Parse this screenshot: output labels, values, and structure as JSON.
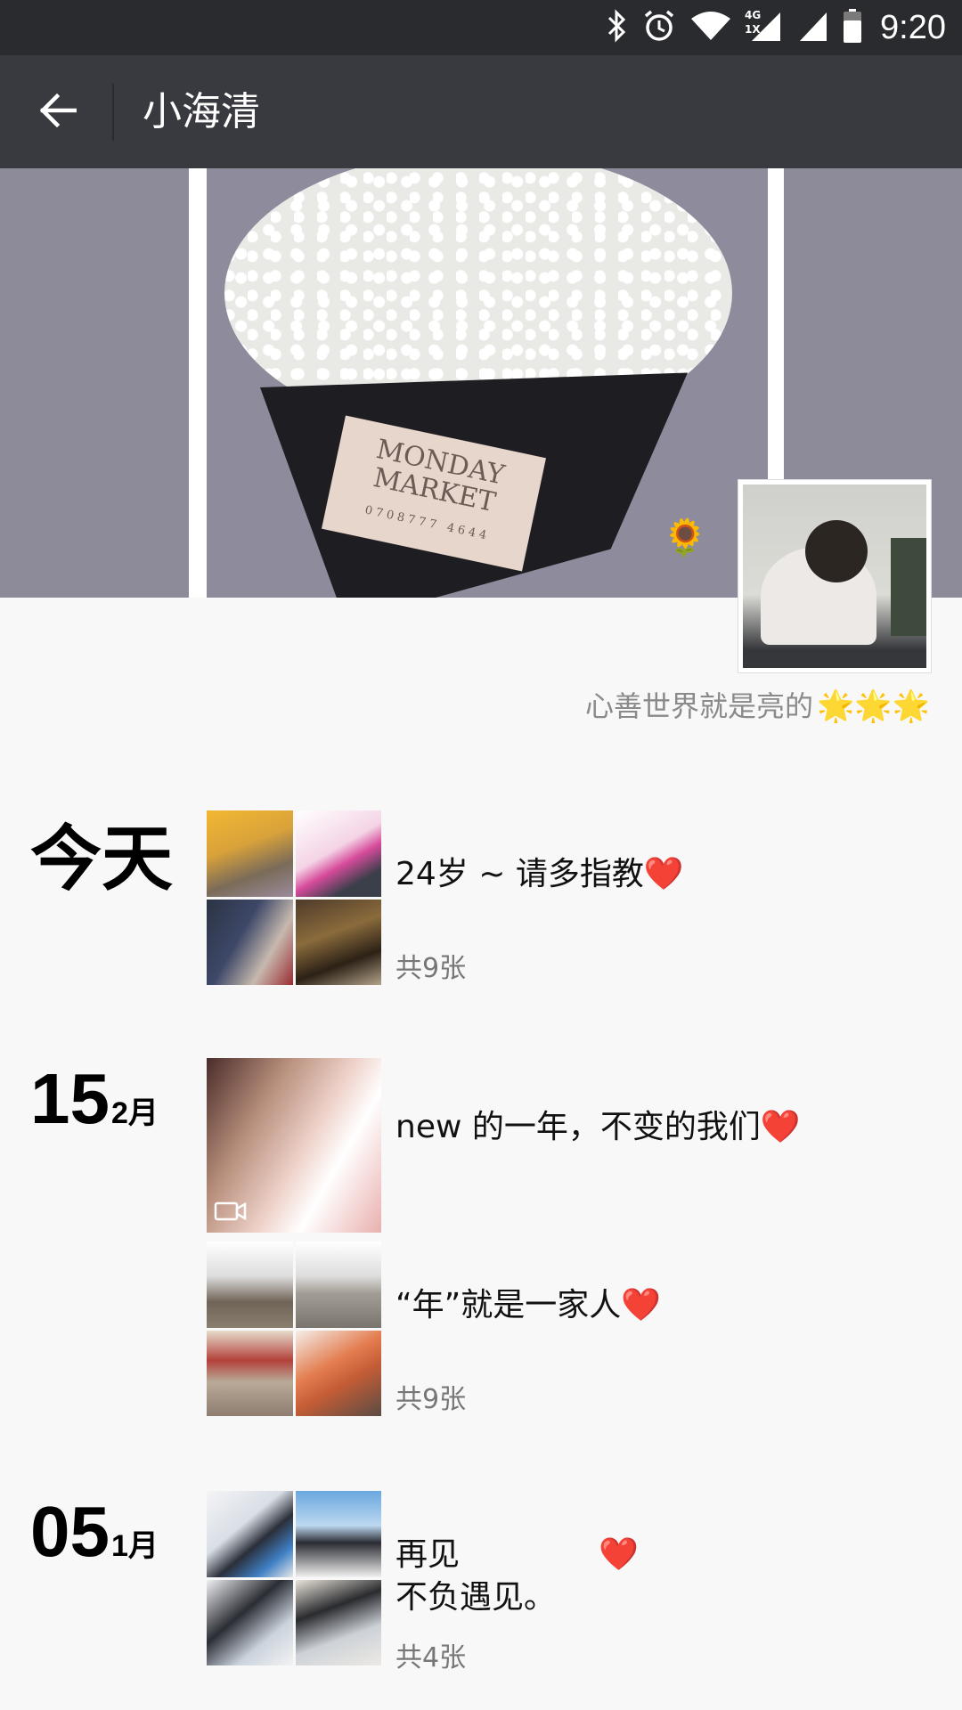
{
  "status_bar": {
    "time": "9:20",
    "network_label": "4G",
    "sim_label": "1X",
    "icons": [
      "bluetooth-icon",
      "alarm-icon",
      "wifi-icon",
      "cellular-signal-icon",
      "cellular-signal-icon",
      "battery-icon"
    ]
  },
  "header": {
    "back_icon": "arrow-left-icon",
    "title": "小海清"
  },
  "cover": {
    "tag_line1": "MONDAY",
    "tag_line2": "MARKET",
    "tag_number": "0708777 4644",
    "sunflower": "🌻"
  },
  "profile": {
    "signature": "心善世界就是亮的",
    "signature_stars": "🌟🌟🌟"
  },
  "timeline": [
    {
      "date_label": "今天",
      "posts": [
        {
          "text": "24岁 ~ 请多指教",
          "heart": "❤️",
          "count": "共9张"
        }
      ]
    },
    {
      "day": "15",
      "month": "2月",
      "posts": [
        {
          "text": "new 的一年，不变的我们",
          "heart": "❤️"
        },
        {
          "text": "“年”就是一家人",
          "heart": "❤️",
          "count": "共9张"
        }
      ]
    },
    {
      "day": "05",
      "month": "1月",
      "posts": [
        {
          "text": "再见\n不负遇见。",
          "heart": "❤️",
          "count": "共4张"
        }
      ]
    }
  ],
  "colors": {
    "status_bar_bg": "#2a2b2f",
    "title_bar_bg": "#393a3f",
    "page_bg": "#f8f8f8",
    "heart": "#e0211f"
  }
}
